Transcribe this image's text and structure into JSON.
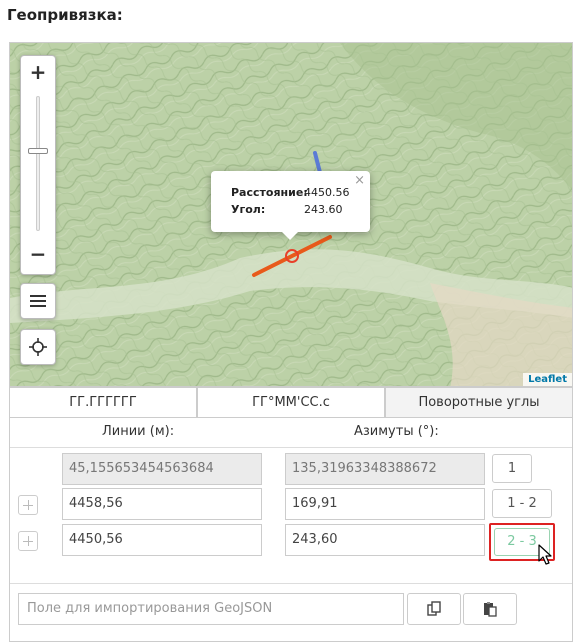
{
  "header": {
    "title": "Геопривязка:"
  },
  "map": {
    "zoom_in_label": "+",
    "zoom_out_label": "−",
    "popup": {
      "distance_label": "Расстояние:",
      "distance_value": "4450.56",
      "angle_label": "Угол:",
      "angle_value": "243.60",
      "close_label": "×"
    },
    "attribution": "Leaflet",
    "colors": {
      "segment_active": "#e85a1b",
      "segment_prev": "#5b7bd5",
      "marker": "#e8402a"
    }
  },
  "tabs": [
    {
      "label": "ГГ.ГГГГГГ"
    },
    {
      "label": "ГГ°ММ'СС.с"
    },
    {
      "label": "Поворотные углы",
      "active": true
    }
  ],
  "table": {
    "lines_header": "Линии (м):",
    "azimuth_header": "Азимуты (°):",
    "rows": [
      {
        "line": "45,155653454563684",
        "azimuth": "135,31963348388672",
        "point": "1"
      },
      {
        "line": "4458,56",
        "azimuth": "169,91",
        "point": "1 - 2"
      },
      {
        "line": "4450,56",
        "azimuth": "243,60",
        "point": "2 - 3"
      }
    ]
  },
  "import": {
    "placeholder": "Поле для импортирования GeoJSON"
  }
}
